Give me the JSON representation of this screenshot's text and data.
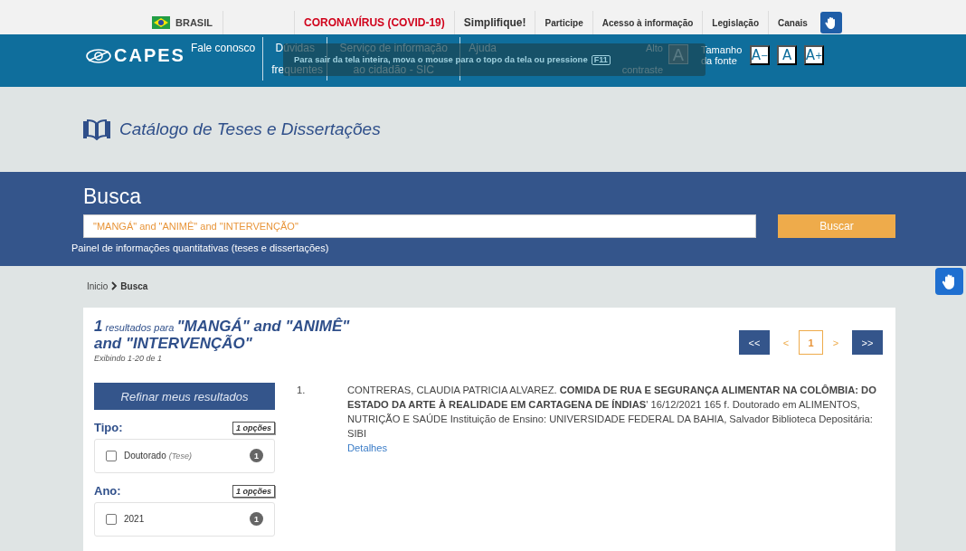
{
  "top_bar": {
    "country": "BRASIL",
    "links": [
      {
        "label": "CORONAVÍRUS (COVID-19)",
        "kind": "alert"
      },
      {
        "label": "Simplifique!",
        "kind": "strong"
      },
      {
        "label": "Participe",
        "kind": "normal"
      },
      {
        "label": "Acesso à informação",
        "kind": "normal"
      },
      {
        "label": "Legislação",
        "kind": "normal"
      },
      {
        "label": "Canais",
        "kind": "normal"
      }
    ]
  },
  "header": {
    "logo": "CAPES",
    "nav": [
      "Fale conosco",
      "Dúvidas frequentes",
      "Serviço de informação ao cidadão - SIC",
      "Ajuda"
    ],
    "contrast_label": "Alto contraste",
    "contrast_button": "A",
    "font_label": "Tamanho da fonte",
    "font_buttons": [
      "A$^{−}$",
      "A",
      "A$^{+}$"
    ]
  },
  "fullscreen_notice": {
    "text": "Para sair da tela inteira, mova o mouse para o topo da tela ou pressione",
    "key": "F11"
  },
  "catalog_title": "Catálogo de Teses e Dissertações",
  "search": {
    "heading": "Busca",
    "value": "\"MANGÁ\" and \"ANIMÊ\" and \"INTERVENÇÃO\"",
    "button": "Buscar",
    "panel_link": "Painel de informações quantitativas (teses e dissertações)"
  },
  "breadcrumb": [
    {
      "label": "Inicio",
      "current": false
    },
    {
      "label": "Busca",
      "current": true
    }
  ],
  "results": {
    "count": "1",
    "label": "resultados para",
    "query": "\"MANGÁ\" and \"ANIMÊ\" and \"INTERVENÇÃO\"",
    "showing": "Exibindo 1-20 de 1"
  },
  "pagination": [
    {
      "label": "<<",
      "kind": "jump",
      "selected": false
    },
    {
      "label": "<",
      "kind": "step",
      "selected": false
    },
    {
      "label": "1",
      "kind": "page",
      "selected": true
    },
    {
      "label": ">",
      "kind": "step",
      "selected": false
    },
    {
      "label": ">>",
      "kind": "jump",
      "selected": false
    }
  ],
  "refine_button": "Refinar meus resultados",
  "filters": [
    {
      "title": "Tipo:",
      "options": "1 opções",
      "items": [
        {
          "label": "Doutorado",
          "note": "(Tese)",
          "count": "1",
          "checked": false
        }
      ]
    },
    {
      "title": "Ano:",
      "options": "1 opções",
      "items": [
        {
          "label": "2021",
          "count": "1",
          "checked": false
        }
      ]
    }
  ],
  "records": [
    {
      "number": "1.",
      "text": "CONTRERAS, CLAUDIA PATRICIA ALVAREZ. **COMIDA DE RUA E SEGURANÇA ALIMENTAR NA COLÔMBIA: DO ESTADO DA ARTE À REALIDADE EM CARTAGENA DE ÍNDIAS**' 16/12/2021 165 f. Doutorado em ALIMENTOS, NUTRIÇÃO E SAÚDE Instituição de Ensino: UNIVERSIDADE FEDERAL DA BAHIA, Salvador Biblioteca Depositária: SIBI",
      "link": "Detalhes"
    }
  ]
}
